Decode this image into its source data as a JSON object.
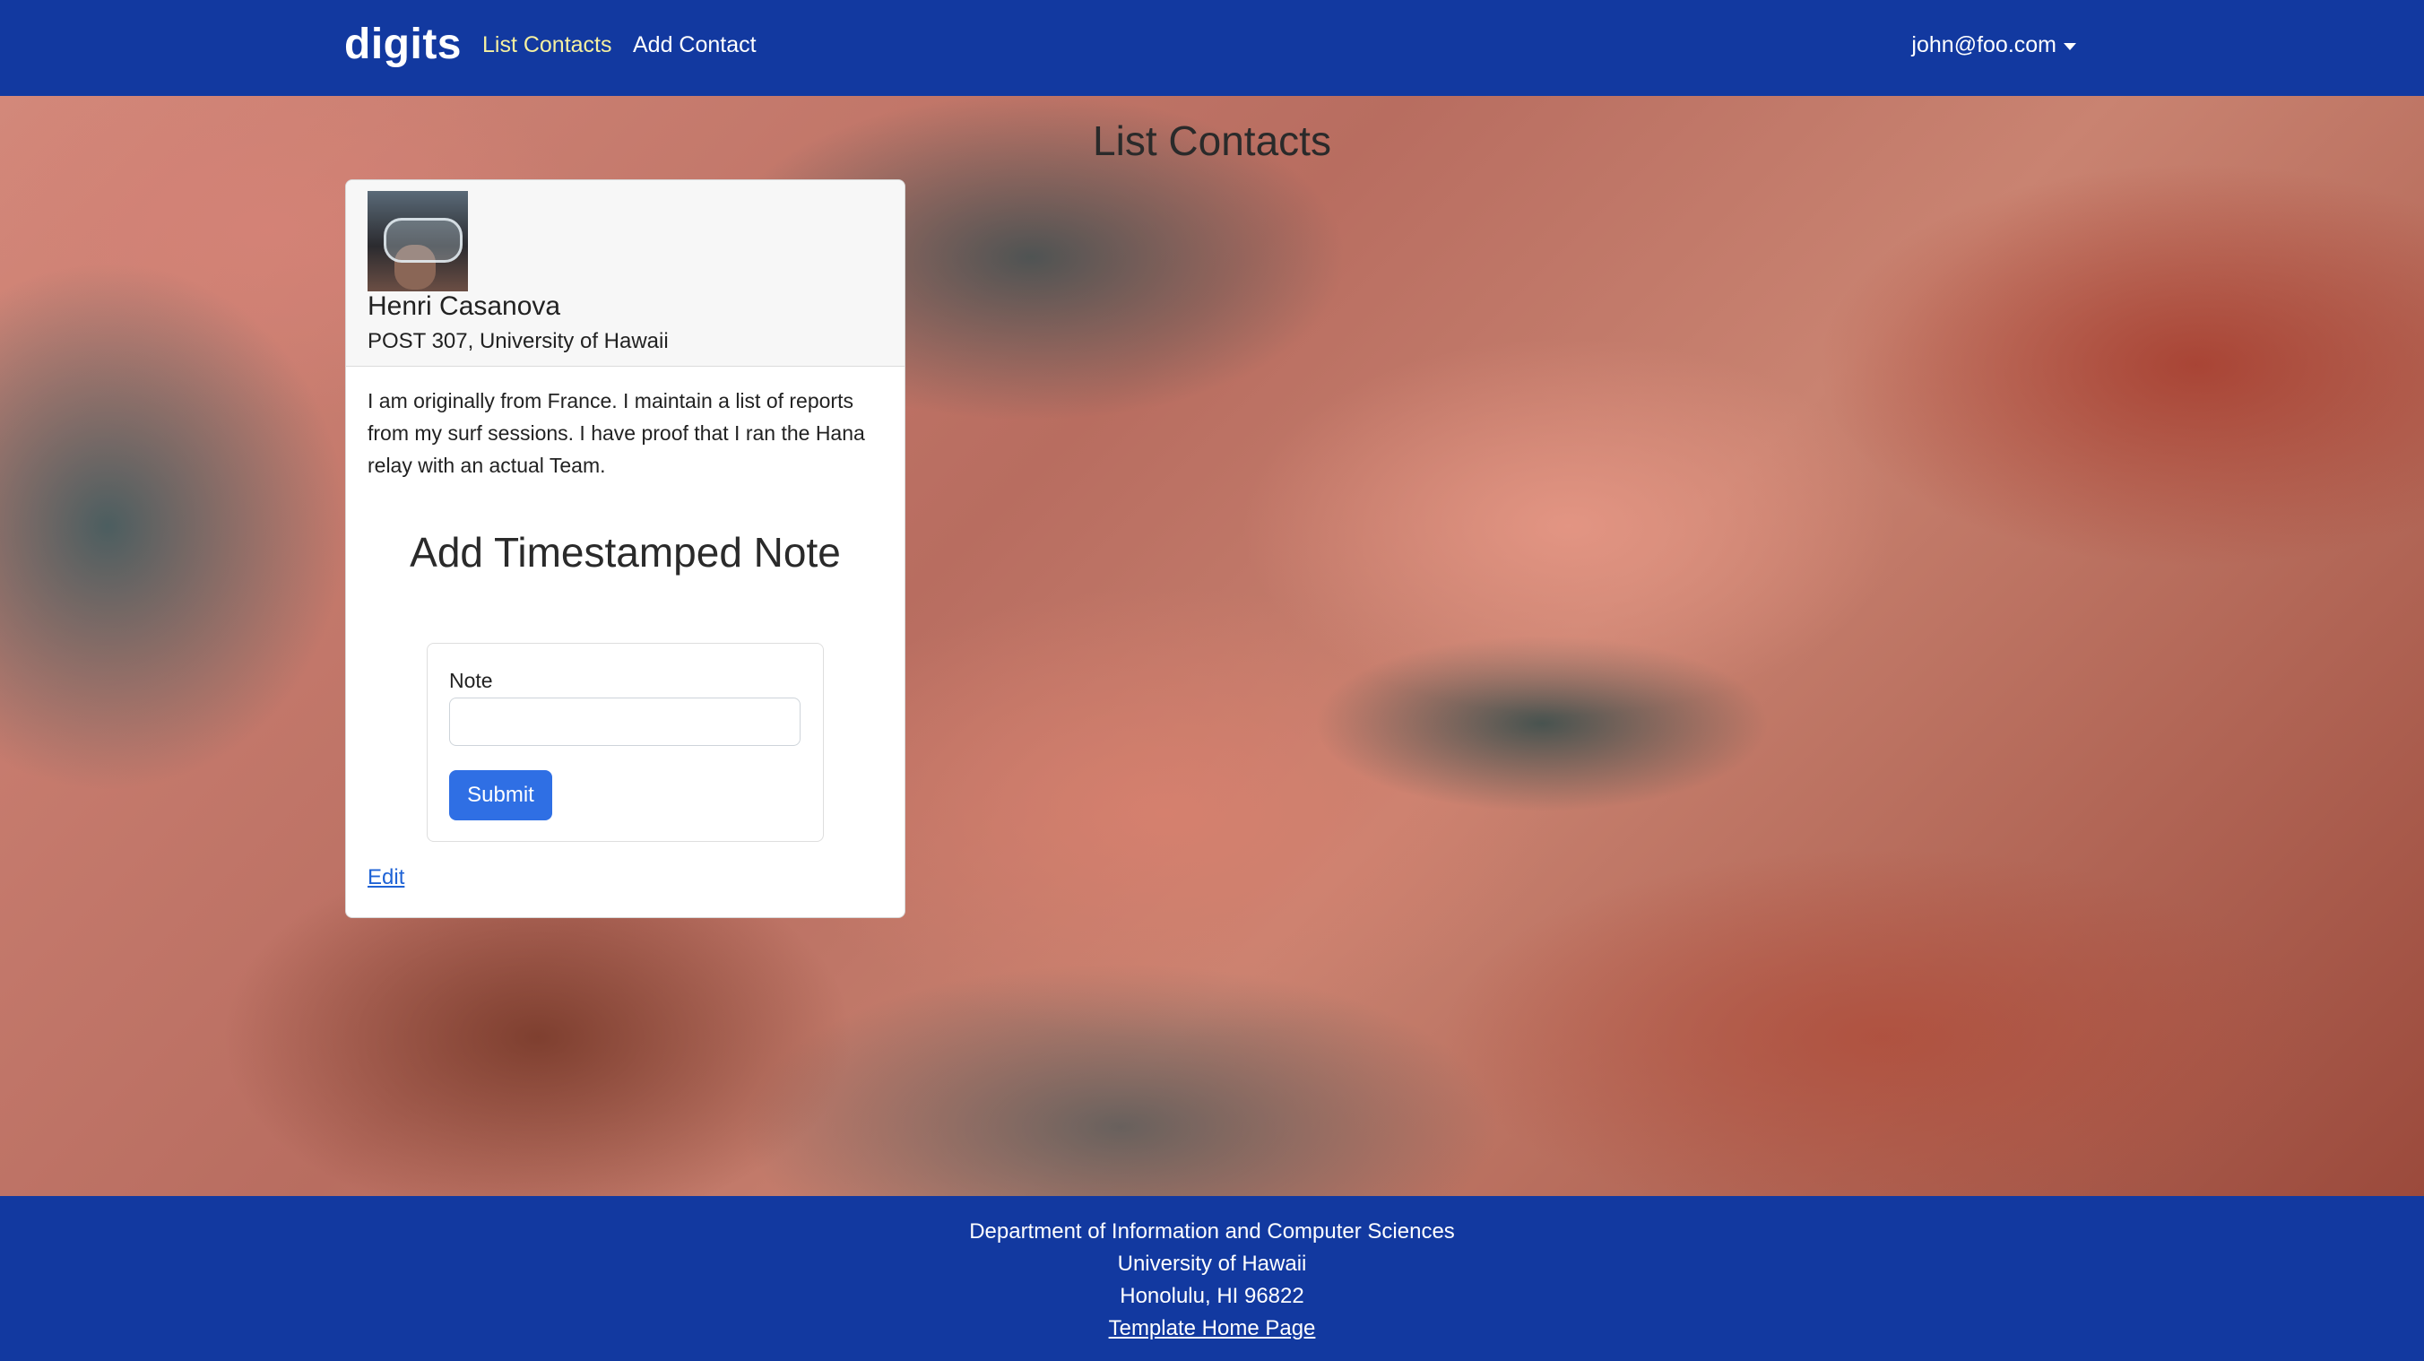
{
  "navbar": {
    "brand": "digits",
    "links": [
      {
        "label": "List Contacts",
        "active": true
      },
      {
        "label": "Add Contact",
        "active": false
      }
    ],
    "user": "john@foo.com"
  },
  "page": {
    "title": "List Contacts"
  },
  "contact": {
    "name": "Henri Casanova",
    "address": "POST 307, University of Hawaii",
    "description": "I am originally from France. I maintain a list of reports from my surf sessions. I have proof that I ran the Hana relay with an actual Team.",
    "note_form": {
      "title": "Add Timestamped Note",
      "label": "Note",
      "value": "",
      "submit_label": "Submit"
    },
    "edit_label": "Edit"
  },
  "footer": {
    "line1": "Department of Information and Computer Sciences",
    "line2": "University of Hawaii",
    "line3": "Honolulu, HI 96822",
    "link": "Template Home Page"
  },
  "colors": {
    "navbar": "#1239a0",
    "active_link": "#f6f0a0",
    "button": "#2f6fe4"
  }
}
